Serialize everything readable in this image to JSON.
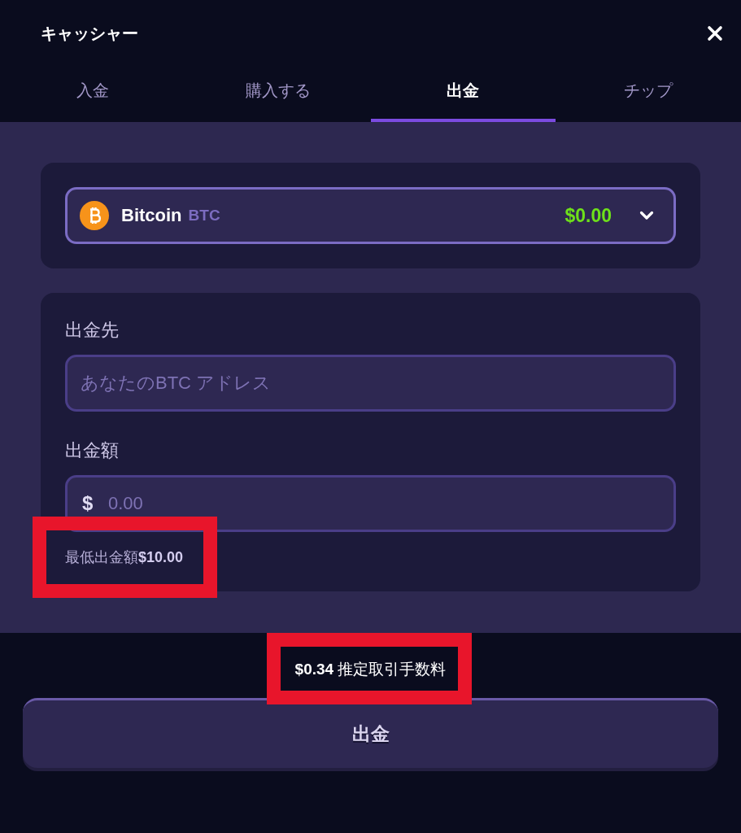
{
  "window": {
    "title": "キャッシャー"
  },
  "tabs": [
    {
      "label": "入金",
      "selected": false
    },
    {
      "label": "購入する",
      "selected": false
    },
    {
      "label": "出金",
      "selected": true
    },
    {
      "label": "チップ",
      "selected": false
    }
  ],
  "currency_select": {
    "name": "Bitcoin",
    "symbol": "BTC",
    "balance": "$0.00"
  },
  "fields": [
    {
      "kind": "text",
      "label": "出金先",
      "placeholder": "あなたのBTC アドレス"
    },
    {
      "kind": "amount",
      "label": "出金額",
      "prefix": "$",
      "placeholder": "0.00"
    }
  ],
  "minimum_note": {
    "text": "最低出金額**$10.00**",
    "highlighted": true
  },
  "fee_note": {
    "text": "**$0.34** 推定取引手数料",
    "highlighted": true
  },
  "submit_button": {
    "label": "出金"
  }
}
